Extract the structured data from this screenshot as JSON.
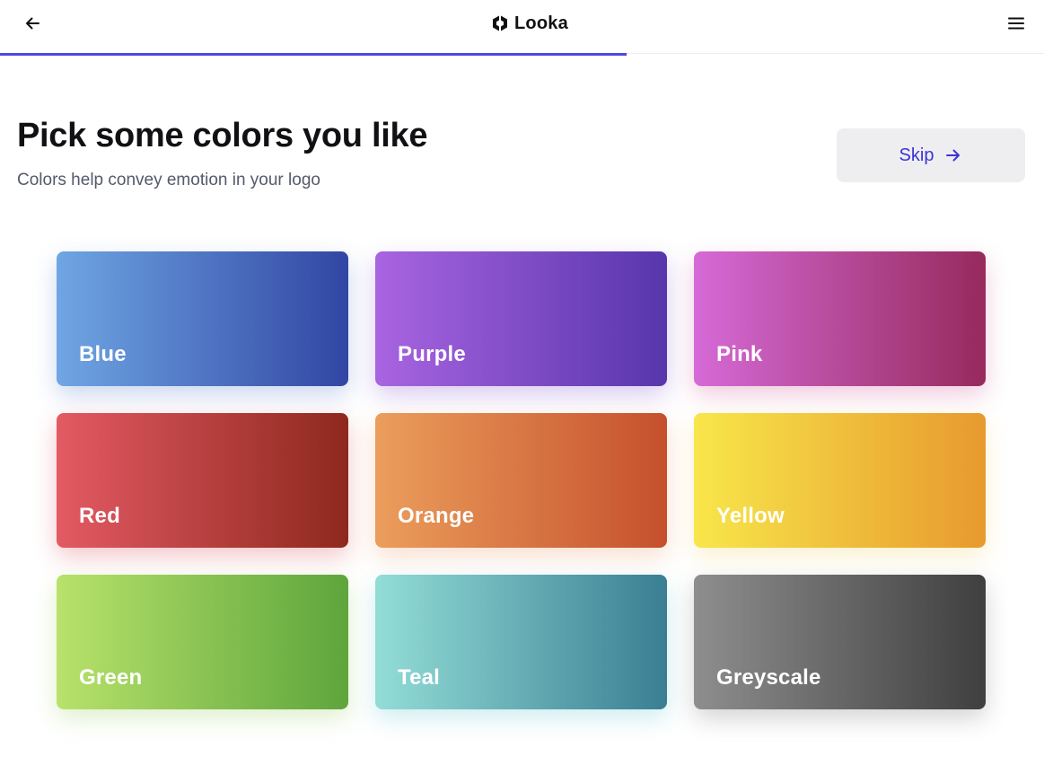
{
  "header": {
    "brand_name": "Looka",
    "progress_percent": 60
  },
  "main": {
    "title": "Pick some colors you like",
    "subtitle": "Colors help convey emotion in your logo",
    "skip_label": "Skip"
  },
  "colors": [
    {
      "label": "Blue",
      "from": "#6fa6e3",
      "to": "#3146a3",
      "shadow": "rgba(70,110,200,0.28)"
    },
    {
      "label": "Purple",
      "from": "#a964e1",
      "to": "#5736ab",
      "shadow": "rgba(120,70,200,0.28)"
    },
    {
      "label": "Pink",
      "from": "#d66ad7",
      "to": "#962a5c",
      "shadow": "rgba(200,70,140,0.28)"
    },
    {
      "label": "Red",
      "from": "#e35a63",
      "to": "#8e281e",
      "shadow": "rgba(220,70,80,0.30)"
    },
    {
      "label": "Orange",
      "from": "#eb9e5c",
      "to": "#c5502c",
      "shadow": "rgba(230,130,70,0.26)"
    },
    {
      "label": "Yellow",
      "from": "#f8e64a",
      "to": "#e79a2e",
      "shadow": "rgba(240,200,70,0.26)"
    },
    {
      "label": "Green",
      "from": "#b8e26b",
      "to": "#5ea53c",
      "shadow": "rgba(140,200,80,0.28)"
    },
    {
      "label": "Teal",
      "from": "#93ddd7",
      "to": "#3a7e93",
      "shadow": "rgba(80,190,200,0.28)"
    },
    {
      "label": "Greyscale",
      "from": "#8e8e8e",
      "to": "#3f3f3f",
      "shadow": "rgba(60,60,60,0.22)"
    }
  ]
}
